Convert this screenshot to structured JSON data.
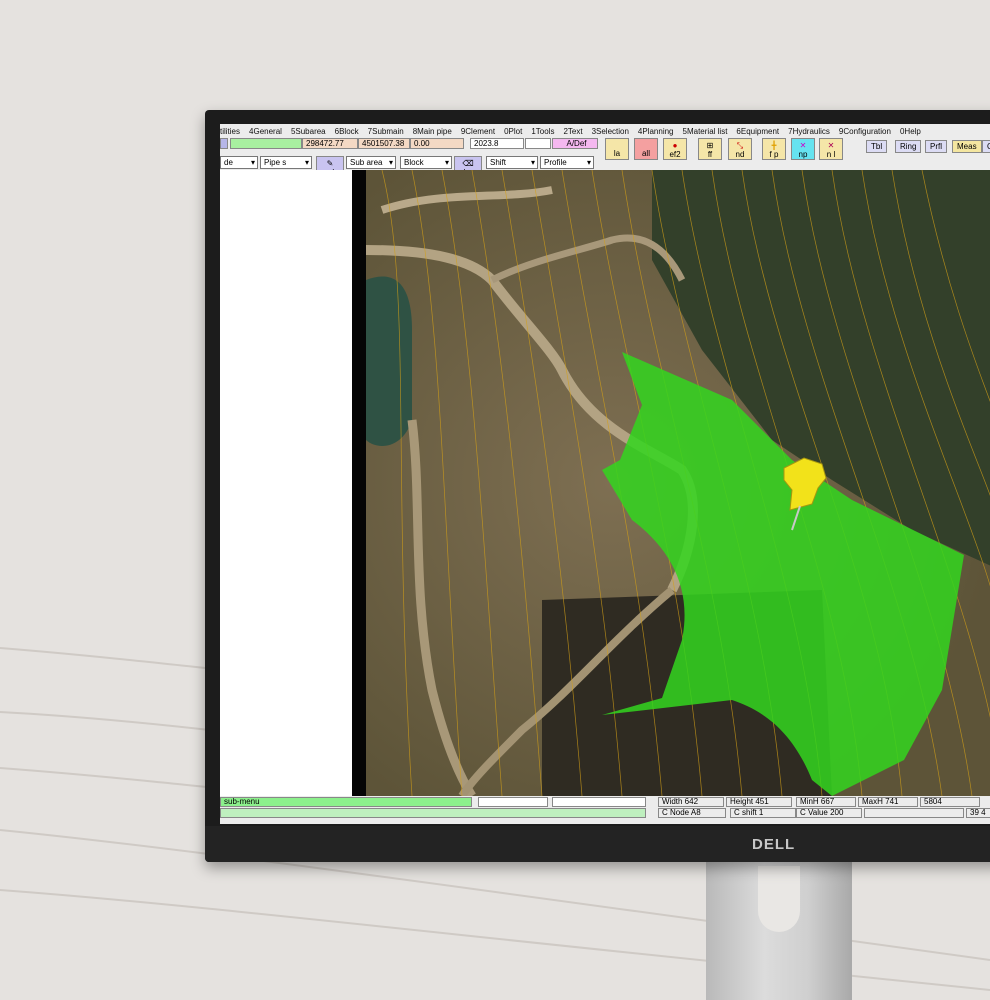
{
  "monitor_brand": "DELL",
  "menu": [
    "tilities",
    "4General",
    "5Subarea",
    "6Block",
    "7Submain",
    "8Main pipe",
    "9Clement",
    "0Plot",
    "1Tools",
    "2Text",
    "3Selection",
    "4Planning",
    "5Material list",
    "6Equipment",
    "7Hydraulics",
    "9Configuration",
    "0Help"
  ],
  "coords": {
    "x": "298472.77",
    "y": "4501507.38",
    "z": "0.00",
    "elev": "2023.8",
    "mode": "A/Def"
  },
  "toolbar_buttons": [
    {
      "label": "la",
      "color": "#f5e6a8",
      "icon": "text-icon"
    },
    {
      "label": "all",
      "color": "#f4a0a0",
      "icon": "text-icon"
    },
    {
      "label": "ef2",
      "color": "#f5e6a8",
      "icon": "red-marker-icon"
    },
    {
      "label": "ff",
      "color": "#f5e6a8",
      "icon": "grid-icon"
    },
    {
      "label": "nd",
      "color": "#f5e6a8",
      "icon": "node-icon"
    },
    {
      "label": "f p",
      "color": "#f5e6a8",
      "icon": "crosshair-icon"
    },
    {
      "label": "np",
      "color": "#66e3f0",
      "icon": "pipe-icon"
    },
    {
      "label": "n l",
      "color": "#f5e6a8",
      "icon": "line-icon"
    }
  ],
  "small_buttons": [
    "Tbl",
    "Ring",
    "Prfl",
    "Meas",
    "C"
  ],
  "selects": {
    "node": "de",
    "pipe": "Pipe s",
    "subarea": "Sub area",
    "block": "Block",
    "shift": "Shift",
    "profile": "Profile"
  },
  "tool_ml": "ml",
  "tool_bz": "bz",
  "status": {
    "submenu": "sub-menu",
    "width": "Width   642",
    "height": "Height   451",
    "minh": "MinH   667",
    "maxh": "MaxH   741",
    "val": "5804",
    "cnode": "C Node   A8",
    "cshift": "C shift   1",
    "cvalue": "C Value   200",
    "last": "39  4"
  },
  "colors": {
    "highlight": "#33d61f",
    "contour": "#d4a017",
    "pin": "#f2e21a"
  }
}
